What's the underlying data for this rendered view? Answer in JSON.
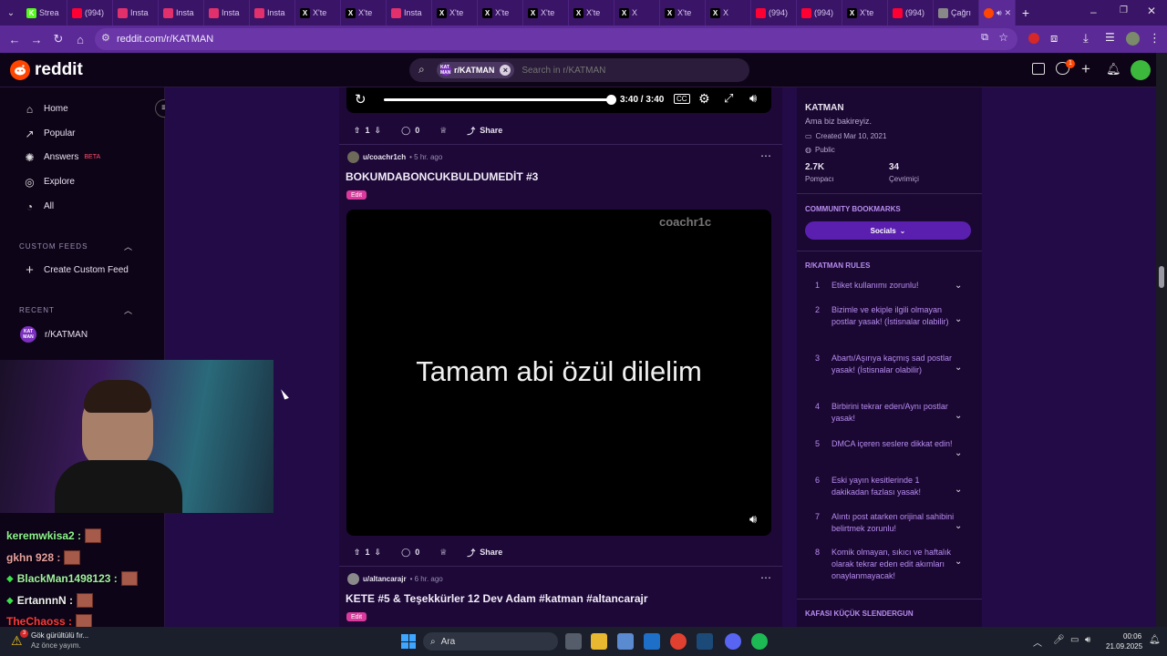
{
  "browser": {
    "tabs": [
      {
        "label": "Strea",
        "icon": "K",
        "color": "#53fc18"
      },
      {
        "label": "(994)",
        "icon": "yt",
        "color": "#ff0033"
      },
      {
        "label": "Insta",
        "icon": "ig",
        "color": "#e1306c"
      },
      {
        "label": "Insta",
        "icon": "ig",
        "color": "#e1306c"
      },
      {
        "label": "Insta",
        "icon": "ig",
        "color": "#e1306c"
      },
      {
        "label": "Insta",
        "icon": "ig",
        "color": "#e1306c"
      },
      {
        "label": "X'te",
        "icon": "X",
        "color": "#000000"
      },
      {
        "label": "X'te",
        "icon": "X",
        "color": "#000000"
      },
      {
        "label": "Insta",
        "icon": "ig",
        "color": "#e1306c"
      },
      {
        "label": "X'te",
        "icon": "X",
        "color": "#000000"
      },
      {
        "label": "X'te",
        "icon": "X",
        "color": "#000000"
      },
      {
        "label": "X'te",
        "icon": "X",
        "color": "#000000"
      },
      {
        "label": "X'te",
        "icon": "X",
        "color": "#000000"
      },
      {
        "label": "X",
        "icon": "X",
        "color": "#000000"
      },
      {
        "label": "X'te",
        "icon": "X",
        "color": "#000000"
      },
      {
        "label": "X",
        "icon": "X",
        "color": "#000000"
      },
      {
        "label": "(994)",
        "icon": "yt",
        "color": "#ff0033"
      },
      {
        "label": "(994)",
        "icon": "yt",
        "color": "#ff0033"
      },
      {
        "label": "X'te",
        "icon": "X",
        "color": "#000000"
      },
      {
        "label": "(994)",
        "icon": "yt",
        "color": "#ff0033"
      },
      {
        "label": "Çağrı",
        "icon": "globe",
        "color": "#888888"
      }
    ],
    "url": "reddit.com/r/KATMAN"
  },
  "header": {
    "logo_text": "reddit",
    "search_chip": "r/KATMAN",
    "search_chip_icon": "KAT MAN",
    "search_placeholder": "Search in r/KATMAN",
    "notif_count": "1"
  },
  "sidebar": {
    "items": [
      {
        "label": "Home",
        "icon": "home-icon"
      },
      {
        "label": "Popular",
        "icon": "popular-icon"
      },
      {
        "label": "Answers",
        "icon": "answers-icon",
        "badge": "BETA"
      },
      {
        "label": "Explore",
        "icon": "explore-icon"
      },
      {
        "label": "All",
        "icon": "all-icon"
      }
    ],
    "custom_feeds_title": "CUSTOM FEEDS",
    "create_feed_label": "Create Custom Feed",
    "recent_title": "RECENT",
    "recent_item": "r/KATMAN",
    "recent_icon_text": "KAT MAN"
  },
  "player": {
    "time": "3:40 / 3:40",
    "progress": 1.0
  },
  "post1_actions": {
    "votes": "1",
    "comments": "0",
    "share": "Share"
  },
  "post2": {
    "author": "u/coachr1ch",
    "time": "• 5 hr. ago",
    "title": "BOKUMDABONCUKBULDUMEDİT #3",
    "flair": "Edit",
    "watermark": "coachr1c",
    "caption": "Tamam abi özül dilelim",
    "votes": "1",
    "comments": "0",
    "share": "Share"
  },
  "post3": {
    "author": "u/altancarajr",
    "time": "• 6 hr. ago",
    "title": "KETE #5 & Teşekkürler 12 Dev Adam #katman #altancarajr",
    "flair": "Edit"
  },
  "community": {
    "name": "KATMAN",
    "tagline": "Ama biz bakireyiz.",
    "created": "Created Mar 10, 2021",
    "visibility": "Public",
    "members_value": "2.7K",
    "members_label": "Pompacı",
    "online_value": "34",
    "online_label": "Çevrimiçi",
    "bookmarks_title": "COMMUNITY BOOKMARKS",
    "socials_label": "Socials",
    "rules_title": "R/KATMAN RULES",
    "rules": [
      {
        "n": "1",
        "text": "Etiket kullanımı zorunlu!"
      },
      {
        "n": "2",
        "text": "Bizimle ve ekiple ilgili olmayan postlar yasak! (İstisnalar olabilir)"
      },
      {
        "n": "3",
        "text": "Abartı/Aşırıya kaçmış sad postlar yasak! (İstisnalar olabilir)"
      },
      {
        "n": "4",
        "text": "Birbirini tekrar eden/Aynı postlar yasak!"
      },
      {
        "n": "5",
        "text": "DMCA içeren seslere dikkat edin!"
      },
      {
        "n": "6",
        "text": "Eski yayın kesitlerinde 1 dakikadan fazlası yasak!"
      },
      {
        "n": "7",
        "text": "Alıntı post atarken orijinal sahibini belirtmek zorunlu!"
      },
      {
        "n": "8",
        "text": "Komik olmayan, sıkıcı ve haftalık olarak tekrar eden edit akımları onaylanmayacak!"
      }
    ],
    "next_section": "KAFASI KÜÇÜK SLENDERGUN"
  },
  "chat": [
    {
      "user": "keremwkisa2 :",
      "color": "#8ef58e",
      "badge": false
    },
    {
      "user": "gkhn 928 :",
      "color": "#e8a0a0",
      "badge": false
    },
    {
      "user": "BlackMan1498123 :",
      "color": "#a0f0a0",
      "badge": true
    },
    {
      "user": "ErtannnN :",
      "color": "#f0f0f0",
      "badge": true
    },
    {
      "user": "TheChaoss :",
      "color": "#ff3b3b",
      "badge": false
    }
  ],
  "taskbar": {
    "search_label": "Ara",
    "time": "00:06",
    "date": "21.09.2025",
    "notif_title": "Gök gürültülü fır...",
    "notif_sub": "Az önce yayım.",
    "notif_badge": "3"
  }
}
